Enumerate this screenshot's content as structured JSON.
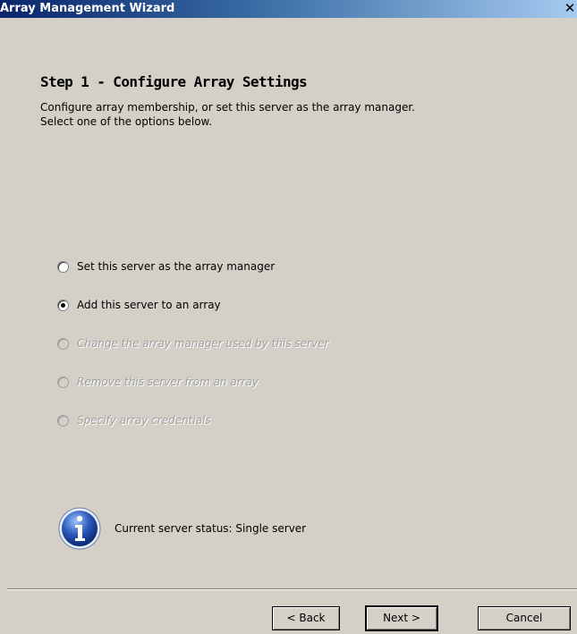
{
  "window": {
    "title": "Array Management Wizard",
    "close_glyph": "✕"
  },
  "step": {
    "heading": "Step 1 - Configure Array Settings",
    "description_line1": "Configure array membership, or set this server as the array manager.",
    "description_line2": "Select one of the options below."
  },
  "options": [
    {
      "label": "Set this server as the array manager",
      "selected": false,
      "enabled": true
    },
    {
      "label": "Add this server to an array",
      "selected": true,
      "enabled": true
    },
    {
      "label": "Change the array manager used by this server",
      "selected": false,
      "enabled": false
    },
    {
      "label": "Remove this server from an array",
      "selected": false,
      "enabled": false
    },
    {
      "label": "Specify array credentials",
      "selected": false,
      "enabled": false
    }
  ],
  "status": {
    "icon": "info-icon",
    "text": "Current server status:  Single server"
  },
  "buttons": {
    "back": "< Back",
    "next": "Next >",
    "cancel": "Cancel"
  },
  "colors": {
    "dialog_bg": "#d4d0c8",
    "title_gradient_start": "#0a246a",
    "title_gradient_end": "#a6caf0",
    "disabled_text": "#a0a0a0",
    "info_icon_blue": "#2a56b8"
  }
}
